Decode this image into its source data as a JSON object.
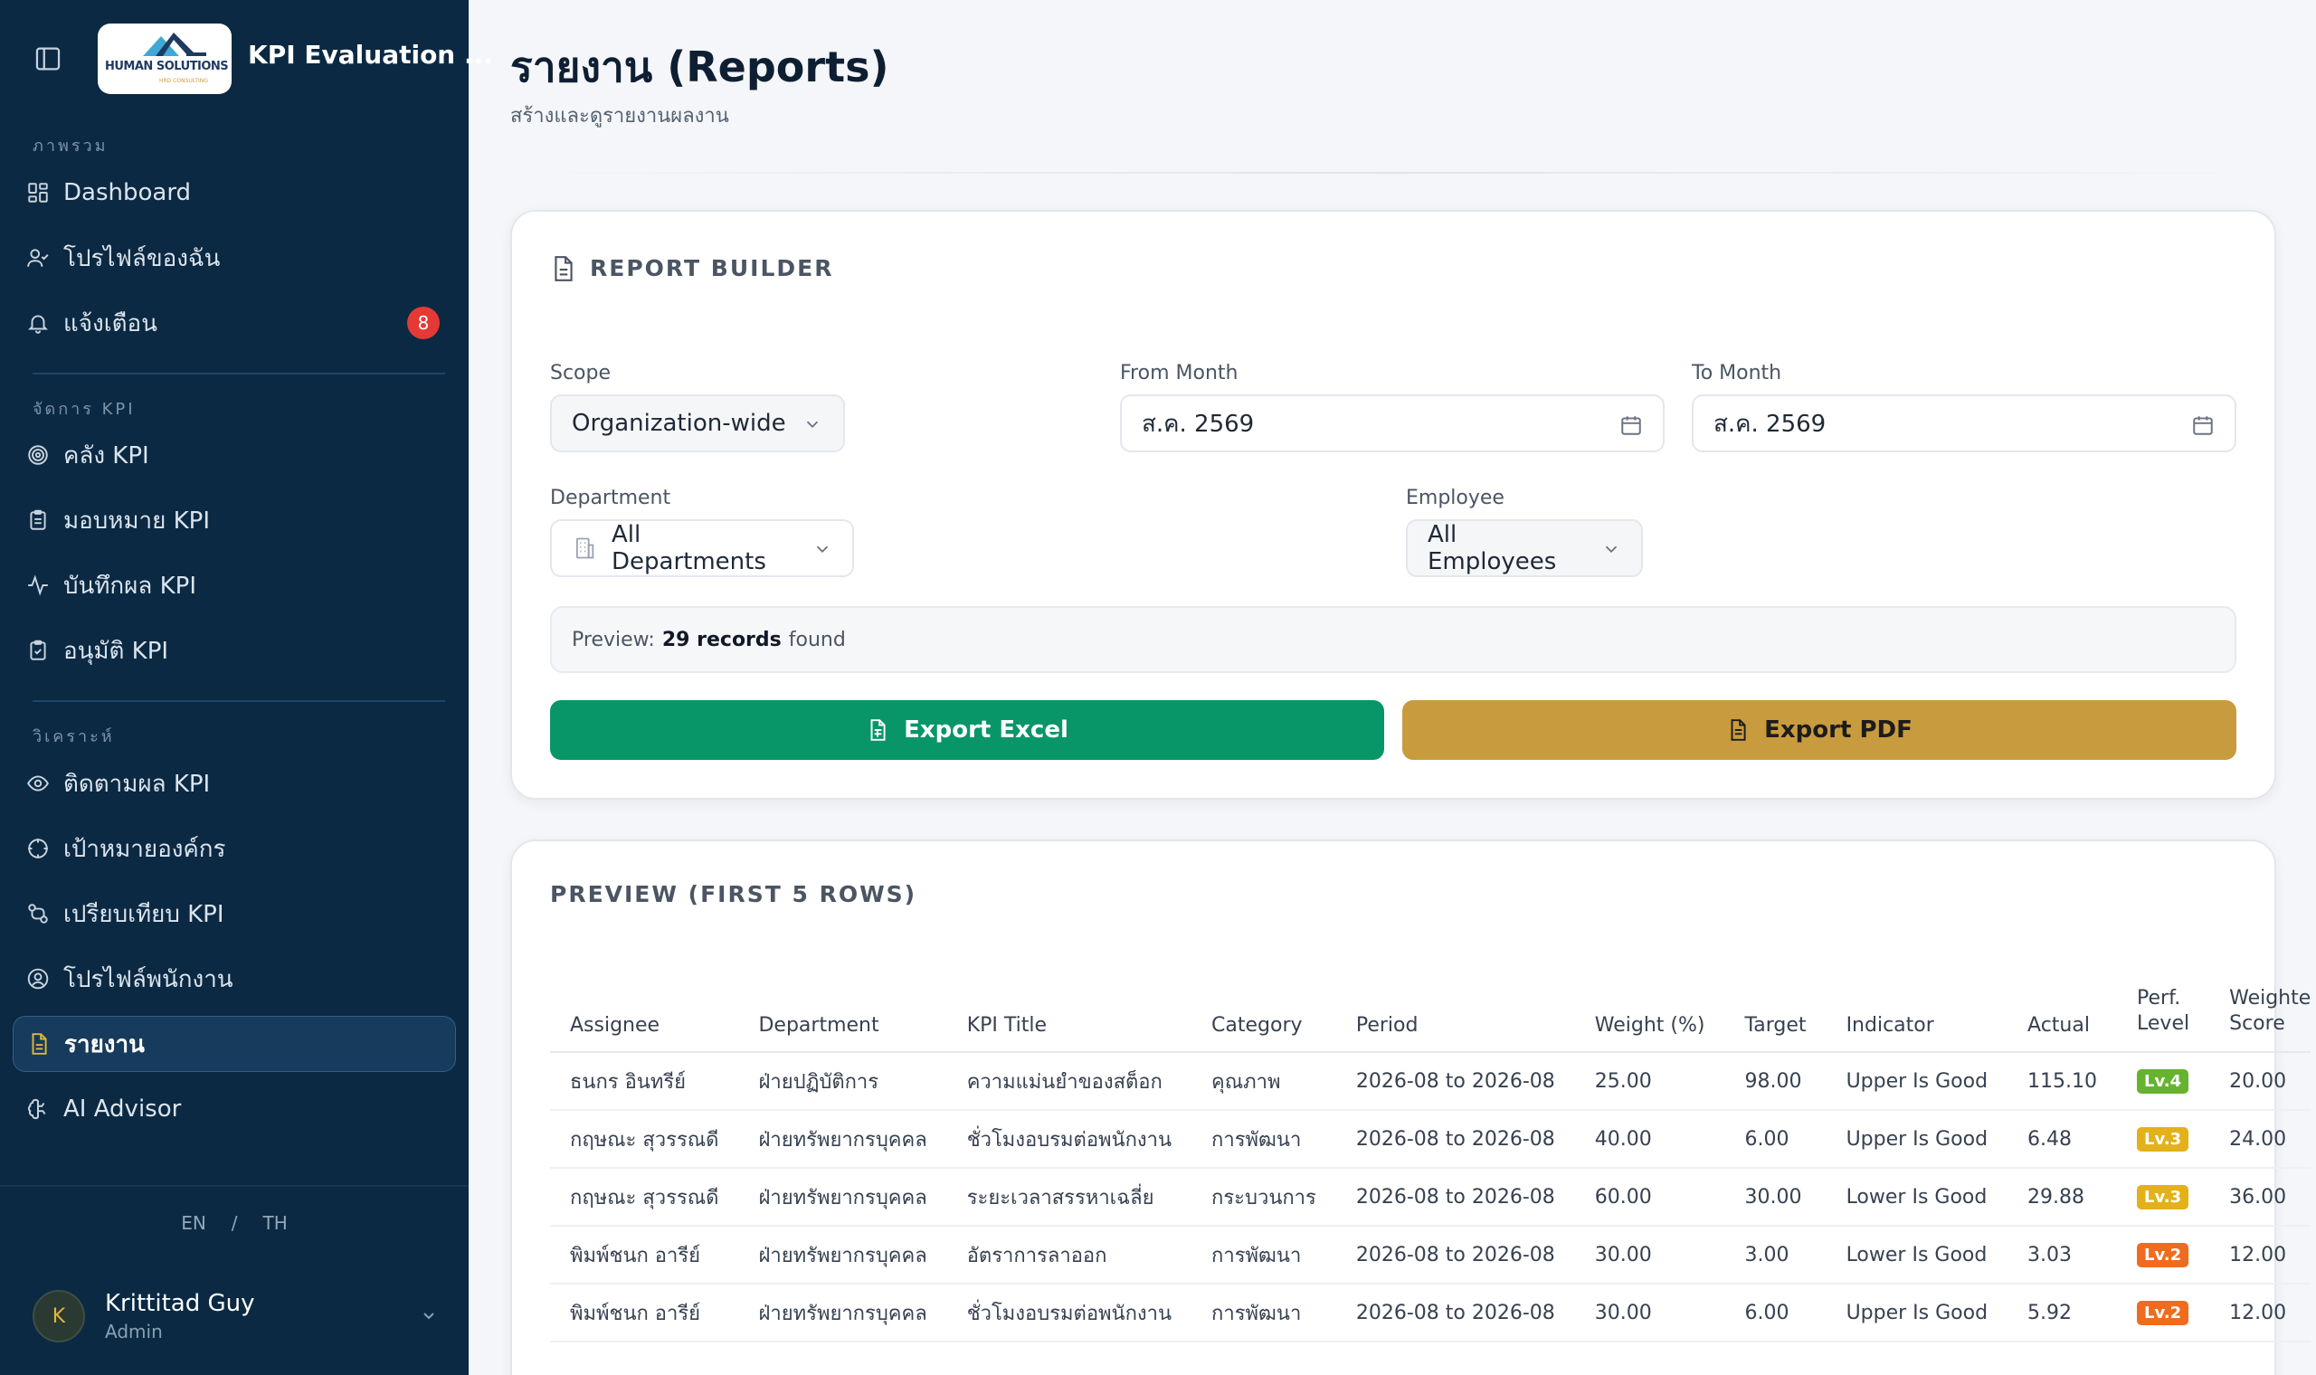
{
  "app": {
    "title": "KPI Evaluation ...",
    "logo_text": "HUMAN SOLUTIONS",
    "logo_sub": "HRD CONSULTING"
  },
  "sidebar": {
    "sections": [
      {
        "label": "ภาพรวม"
      },
      {
        "label": "จัดการ KPI"
      },
      {
        "label": "วิเคราะห์"
      }
    ],
    "items": [
      {
        "label": "Dashboard",
        "icon": "dashboard-icon"
      },
      {
        "label": "โปรไฟล์ของฉัน",
        "icon": "user-icon"
      },
      {
        "label": "แจ้งเตือน",
        "icon": "bell-icon",
        "badge": "8"
      },
      {
        "label": "คลัง KPI",
        "icon": "target-icon"
      },
      {
        "label": "มอบหมาย KPI",
        "icon": "clipboard-list-icon"
      },
      {
        "label": "บันทึกผล KPI",
        "icon": "activity-icon"
      },
      {
        "label": "อนุมัติ KPI",
        "icon": "clipboard-check-icon"
      },
      {
        "label": "ติดตามผล KPI",
        "icon": "eye-icon"
      },
      {
        "label": "เป้าหมายองค์กร",
        "icon": "crosshair-icon"
      },
      {
        "label": "เปรียบเทียบ KPI",
        "icon": "compare-icon"
      },
      {
        "label": "โปรไฟล์พนักงาน",
        "icon": "user-circle-icon"
      },
      {
        "label": "รายงาน",
        "icon": "file-icon",
        "active": true
      },
      {
        "label": "AI Advisor",
        "icon": "brain-icon"
      }
    ],
    "lang": {
      "en": "EN",
      "sep": "/",
      "th": "TH"
    },
    "user": {
      "initial": "K",
      "name": "Krittitad Guy",
      "role": "Admin"
    }
  },
  "page": {
    "title": "รายงาน (Reports)",
    "subtitle": "สร้างและดูรายงานผลงาน"
  },
  "builder": {
    "title": "REPORT BUILDER",
    "scope": {
      "label": "Scope",
      "value": "Organization-wide"
    },
    "from_month": {
      "label": "From Month",
      "value": "ส.ค. 2569"
    },
    "to_month": {
      "label": "To Month",
      "value": "ส.ค. 2569"
    },
    "department": {
      "label": "Department",
      "value": "All Departments"
    },
    "employee": {
      "label": "Employee",
      "value": "All Employees"
    },
    "preview": {
      "prefix": "Preview:",
      "count": "29 records",
      "suffix": "found"
    },
    "export_excel": "Export Excel",
    "export_pdf": "Export PDF"
  },
  "preview_table": {
    "title": "PREVIEW (FIRST 5 ROWS)",
    "columns": [
      "Assignee",
      "Department",
      "KPI Title",
      "Category",
      "Period",
      "Weight (%)",
      "Target",
      "Indicator",
      "Actual",
      "Perf.\nLevel",
      "Weighte\nScore"
    ],
    "rows": [
      {
        "assignee": "ธนกร อินทรีย์",
        "department": "ฝ่ายปฏิบัติการ",
        "kpi_title": "ความแม่นยำของสต็อก",
        "category": "คุณภาพ",
        "period": "2026-08 to 2026-08",
        "weight": "25.00",
        "target": "98.00",
        "indicator": "Upper Is Good",
        "actual": "115.10",
        "level": "Lv.4",
        "level_color": "#65b32e",
        "score": "20.00"
      },
      {
        "assignee": "กฤษณะ สุวรรณดี",
        "department": "ฝ่ายทรัพยากรบุคคล",
        "kpi_title": "ชั่วโมงอบรมต่อพนักงาน",
        "category": "การพัฒนา",
        "period": "2026-08 to 2026-08",
        "weight": "40.00",
        "target": "6.00",
        "indicator": "Upper Is Good",
        "actual": "6.48",
        "level": "Lv.3",
        "level_color": "#e3b11a",
        "score": "24.00"
      },
      {
        "assignee": "กฤษณะ สุวรรณดี",
        "department": "ฝ่ายทรัพยากรบุคคล",
        "kpi_title": "ระยะเวลาสรรหาเฉลี่ย",
        "category": "กระบวนการ",
        "period": "2026-08 to 2026-08",
        "weight": "60.00",
        "target": "30.00",
        "indicator": "Lower Is Good",
        "actual": "29.88",
        "level": "Lv.3",
        "level_color": "#e3b11a",
        "score": "36.00"
      },
      {
        "assignee": "พิมพ์ชนก อารีย์",
        "department": "ฝ่ายทรัพยากรบุคคล",
        "kpi_title": "อัตราการลาออก",
        "category": "การพัฒนา",
        "period": "2026-08 to 2026-08",
        "weight": "30.00",
        "target": "3.00",
        "indicator": "Lower Is Good",
        "actual": "3.03",
        "level": "Lv.2",
        "level_color": "#ef6c1e",
        "score": "12.00"
      },
      {
        "assignee": "พิมพ์ชนก อารีย์",
        "department": "ฝ่ายทรัพยากรบุคคล",
        "kpi_title": "ชั่วโมงอบรมต่อพนักงาน",
        "category": "การพัฒนา",
        "period": "2026-08 to 2026-08",
        "weight": "30.00",
        "target": "6.00",
        "indicator": "Upper Is Good",
        "actual": "5.92",
        "level": "Lv.2",
        "level_color": "#ef6c1e",
        "score": "12.00"
      }
    ]
  },
  "colors": {
    "sidebar_bg": "#0b2942",
    "excel_green": "#089669",
    "pdf_gold": "#c89b3e",
    "badge_red": "#e53935"
  }
}
